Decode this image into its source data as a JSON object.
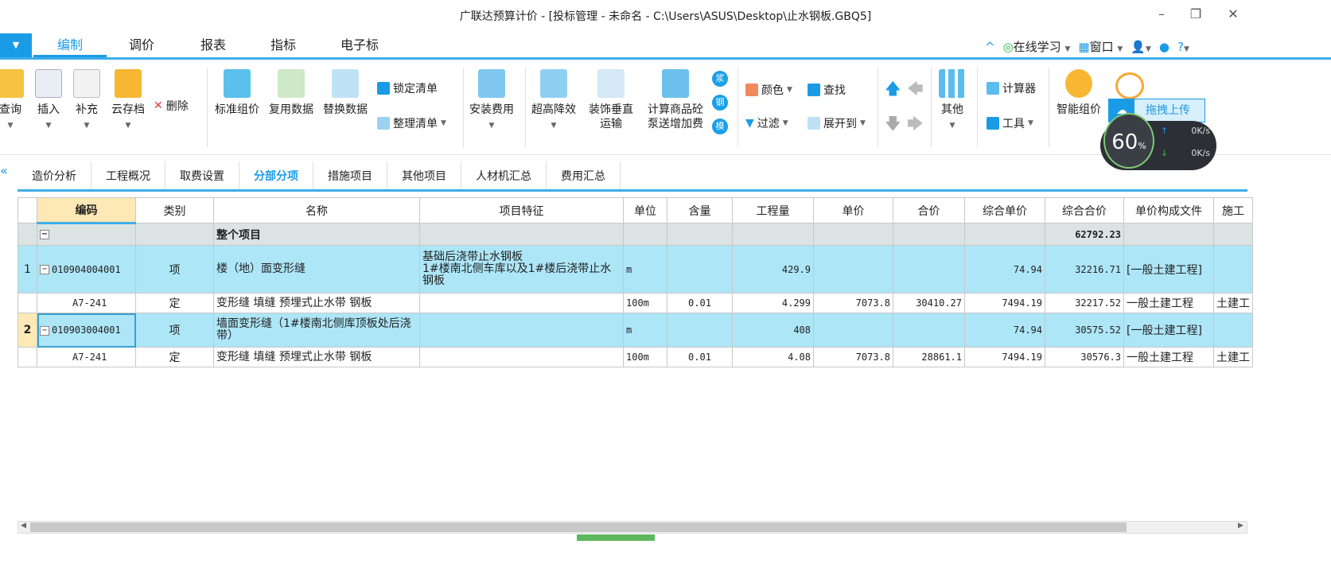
{
  "window": {
    "title": "广联达预算计价 - [投标管理 - 未命名 - C:\\Users\\ASUS\\Desktop\\止水钢板.GBQ5]"
  },
  "menu_tabs": [
    "编制",
    "调价",
    "报表",
    "指标",
    "电子标"
  ],
  "right_menu": {
    "learn": "在线学习",
    "window": "窗口",
    "help": "?"
  },
  "ribbon": {
    "query": "查询",
    "insert": "插入",
    "supplement": "补充",
    "cloud_save": "云存档",
    "delete": "删除",
    "std_price": "标准组价",
    "reuse": "复用数据",
    "replace": "替换数据",
    "lock": "锁定清单",
    "organize": "整理清单",
    "install_fee": "安装费用",
    "high_rise": "超高降效",
    "deco_vertical_1": "装饰垂直",
    "deco_vertical_2": "运输",
    "concrete_1": "计算商品砼",
    "concrete_2": "泵送增加费",
    "badges": [
      "浆",
      "钢",
      "模"
    ],
    "color": "颜色",
    "find": "查找",
    "filter": "过滤",
    "expand": "展开到",
    "other": "其他",
    "calculator": "计算器",
    "tools": "工具",
    "smart_price": "智能组价"
  },
  "float_widget": {
    "upload": "拖拽上传",
    "percent": "60",
    "percent_unit": "%",
    "up": "0K/s",
    "down": "0K/s"
  },
  "sub_tabs": [
    "造价分析",
    "工程概况",
    "取费设置",
    "分部分项",
    "措施项目",
    "其他项目",
    "人材机汇总",
    "费用汇总"
  ],
  "active_sub_tab": "分部分项",
  "table": {
    "headers": [
      "",
      "编码",
      "类别",
      "名称",
      "项目特征",
      "单位",
      "含量",
      "工程量",
      "单价",
      "合价",
      "综合单价",
      "综合合价",
      "单价构成文件",
      "施工"
    ],
    "total_row": {
      "name": "整个项目",
      "total": "62792.23"
    },
    "rows": [
      {
        "no": "1",
        "code": "010904004001",
        "type": "项",
        "name": "楼（地）面变形缝",
        "feature": "基础后浇带止水钢板\n1#楼南北侧车库以及1#楼后浇带止水钢板",
        "unit": "m",
        "qty_ratio": "",
        "qty": "429.9",
        "price": "",
        "amount": "",
        "unit_price": "74.94",
        "total": "32216.71",
        "file": "[一般土建工程]",
        "work": ""
      },
      {
        "no": "",
        "code": "A7-241",
        "type": "定",
        "name": "变形缝 填缝 预埋式止水带 钢板",
        "feature": "",
        "unit": "100m",
        "qty_ratio": "0.01",
        "qty": "4.299",
        "price": "7073.8",
        "amount": "30410.27",
        "unit_price": "7494.19",
        "total": "32217.52",
        "file": "一般土建工程",
        "work": "土建工"
      },
      {
        "no": "2",
        "code": "010903004001",
        "type": "项",
        "name": "墙面变形缝（1#楼南北侧库顶板处后浇带）",
        "feature": "",
        "unit": "m",
        "qty_ratio": "",
        "qty": "408",
        "price": "",
        "amount": "",
        "unit_price": "74.94",
        "total": "30575.52",
        "file": "[一般土建工程]",
        "work": ""
      },
      {
        "no": "",
        "code": "A7-241",
        "type": "定",
        "name": "变形缝 填缝 预埋式止水带 钢板",
        "feature": "",
        "unit": "100m",
        "qty_ratio": "0.01",
        "qty": "4.08",
        "price": "7073.8",
        "amount": "28861.1",
        "unit_price": "7494.19",
        "total": "30576.3",
        "file": "一般土建工程",
        "work": "土建工"
      }
    ]
  },
  "colors": {
    "accent": "#1a9be6",
    "qd_row": "#ade6f7",
    "total_row": "#dce3e3",
    "selected_header": "#fde9b5"
  }
}
